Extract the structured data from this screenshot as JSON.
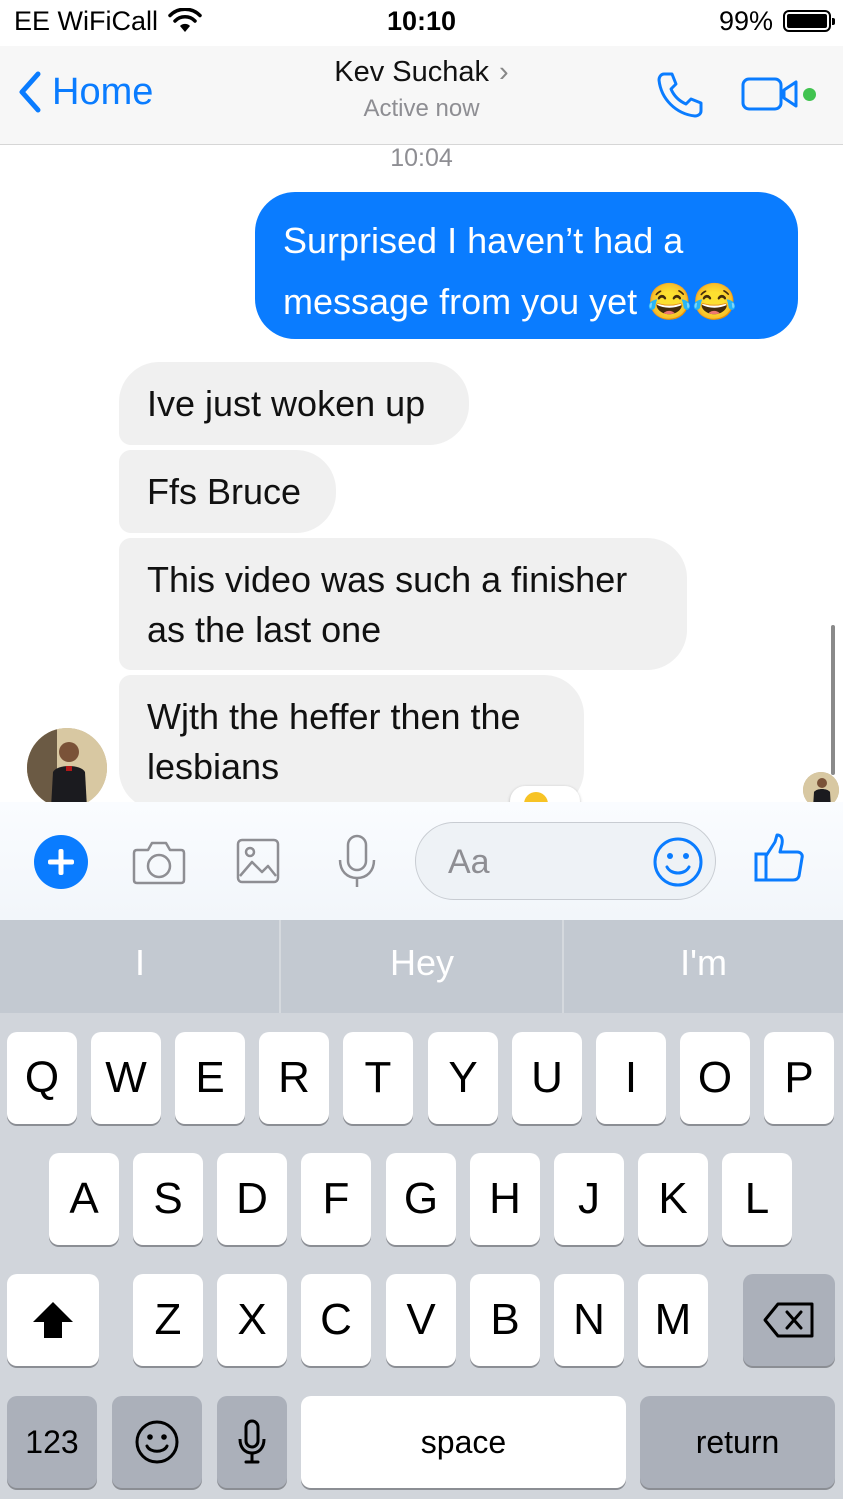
{
  "status_bar": {
    "carrier": "EE WiFiCall",
    "time": "10:10",
    "battery": "99%",
    "battery_level": 0.99
  },
  "nav": {
    "back_label": "Home",
    "contact_name": "Kev Suchak",
    "contact_status": "Active now"
  },
  "conversation": {
    "timestamp": "10:04",
    "outgoing": {
      "text": "Surprised I haven’t had a message from you yet 😂😂"
    },
    "incoming": [
      "Ive just woken up",
      "Ffs Bruce",
      "This video was such a finisher as the last one",
      "Wjth the heffer then the lesbians"
    ]
  },
  "composer": {
    "placeholder": "Aa"
  },
  "suggestions": [
    "I",
    "Hey",
    "I'm"
  ],
  "keyboard": {
    "row1": [
      "Q",
      "W",
      "E",
      "R",
      "T",
      "Y",
      "U",
      "I",
      "O",
      "P"
    ],
    "row2": [
      "A",
      "S",
      "D",
      "F",
      "G",
      "H",
      "J",
      "K",
      "L"
    ],
    "row3": [
      "Z",
      "X",
      "C",
      "V",
      "B",
      "N",
      "M"
    ],
    "numbers_key": "123",
    "space_key": "space",
    "return_key": "return"
  },
  "colors": {
    "accent": "#0a7cff",
    "online": "#41c350",
    "incoming_bubble": "#f0f0f0",
    "keyboard_bg": "#d1d5db"
  }
}
